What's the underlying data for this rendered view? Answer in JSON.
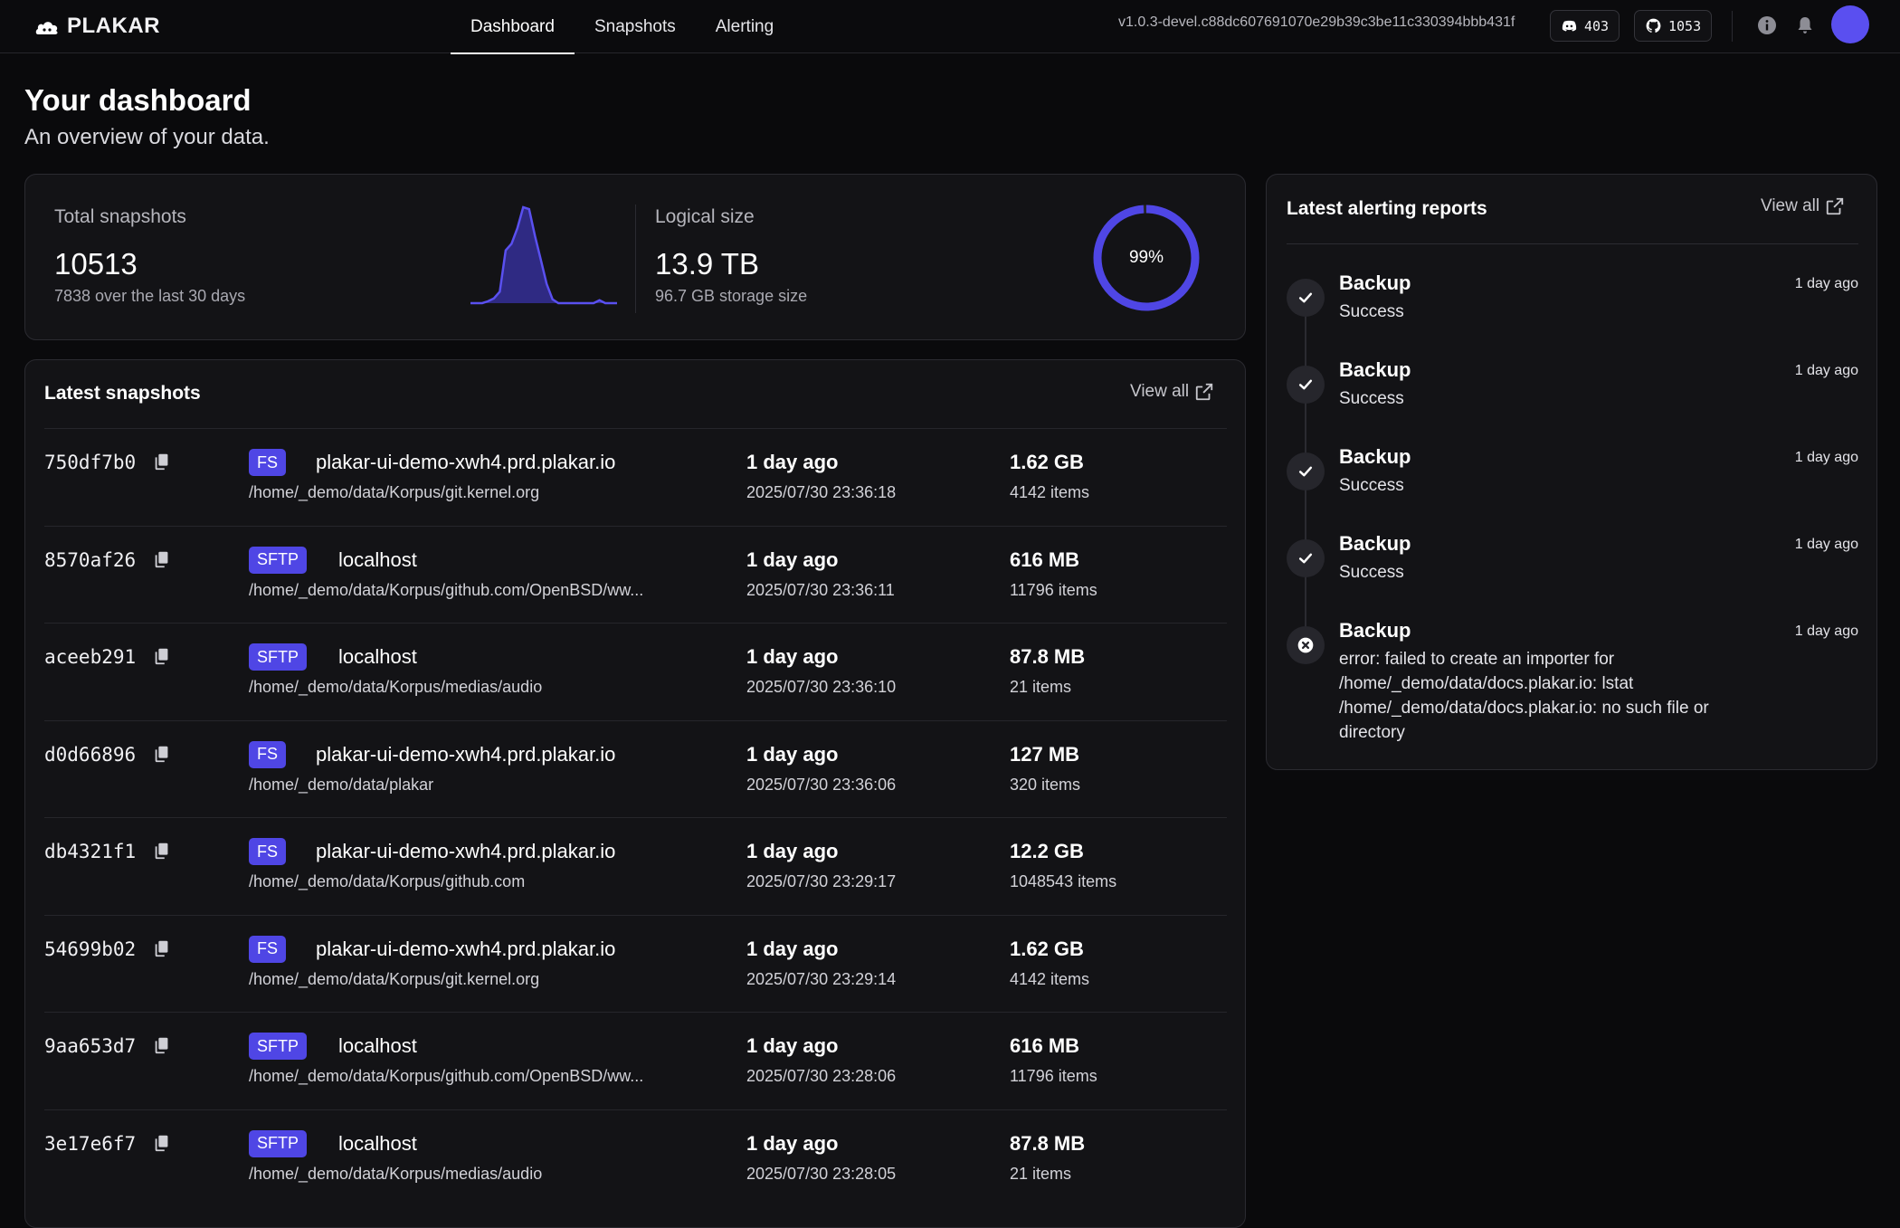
{
  "header": {
    "brand": "PLAKAR",
    "tabs": [
      {
        "label": "Dashboard",
        "active": true
      },
      {
        "label": "Snapshots",
        "active": false
      },
      {
        "label": "Alerting",
        "active": false
      }
    ],
    "version": "v1.0.3-devel.c88dc607691070e29b39c3be11c330394bbb431f",
    "discord_count": "403",
    "github_count": "1053",
    "icons": [
      "discord-icon",
      "github-icon",
      "info-icon",
      "bell-icon",
      "avatar"
    ],
    "accent_color": "#4f46e5"
  },
  "page": {
    "title": "Your dashboard",
    "subtitle": "An overview of your data."
  },
  "stats": {
    "total_label": "Total snapshots",
    "total_value": "10513",
    "total_sub": "7838 over the last 30 days",
    "logical_label": "Logical size",
    "logical_value": "13.9 TB",
    "logical_sub": "96.7 GB storage size",
    "gauge_text": "99%",
    "gauge_fraction": 0.99
  },
  "chart_data": {
    "type": "area",
    "title": "",
    "values": [
      0,
      0,
      0,
      0.02,
      0.05,
      0.12,
      0.55,
      0.62,
      0.78,
      1.0,
      0.98,
      0.7,
      0.45,
      0.2,
      0.04,
      0,
      0,
      0,
      0,
      0,
      0,
      0,
      0.03,
      0,
      0,
      0
    ]
  },
  "snapshots": {
    "title": "Latest snapshots",
    "view_all": "View all",
    "rows": [
      {
        "id": "750df7b0",
        "type": "FS",
        "host": "plakar-ui-demo-xwh4.prd.plakar.io",
        "path": "/home/_demo/data/Korpus/git.kernel.org",
        "ago": "1 day ago",
        "date": "2025/07/30 23:36:18",
        "size": "1.62 GB",
        "items": "4142 items"
      },
      {
        "id": "8570af26",
        "type": "SFTP",
        "host": "localhost",
        "path": "/home/_demo/data/Korpus/github.com/OpenBSD/ww...",
        "ago": "1 day ago",
        "date": "2025/07/30 23:36:11",
        "size": "616 MB",
        "items": "11796 items"
      },
      {
        "id": "aceeb291",
        "type": "SFTP",
        "host": "localhost",
        "path": "/home/_demo/data/Korpus/medias/audio",
        "ago": "1 day ago",
        "date": "2025/07/30 23:36:10",
        "size": "87.8 MB",
        "items": "21 items"
      },
      {
        "id": "d0d66896",
        "type": "FS",
        "host": "plakar-ui-demo-xwh4.prd.plakar.io",
        "path": "/home/_demo/data/plakar",
        "ago": "1 day ago",
        "date": "2025/07/30 23:36:06",
        "size": "127 MB",
        "items": "320 items"
      },
      {
        "id": "db4321f1",
        "type": "FS",
        "host": "plakar-ui-demo-xwh4.prd.plakar.io",
        "path": "/home/_demo/data/Korpus/github.com",
        "ago": "1 day ago",
        "date": "2025/07/30 23:29:17",
        "size": "12.2 GB",
        "items": "1048543 items"
      },
      {
        "id": "54699b02",
        "type": "FS",
        "host": "plakar-ui-demo-xwh4.prd.plakar.io",
        "path": "/home/_demo/data/Korpus/git.kernel.org",
        "ago": "1 day ago",
        "date": "2025/07/30 23:29:14",
        "size": "1.62 GB",
        "items": "4142 items"
      },
      {
        "id": "9aa653d7",
        "type": "SFTP",
        "host": "localhost",
        "path": "/home/_demo/data/Korpus/github.com/OpenBSD/ww...",
        "ago": "1 day ago",
        "date": "2025/07/30 23:28:06",
        "size": "616 MB",
        "items": "11796 items"
      },
      {
        "id": "3e17e6f7",
        "type": "SFTP",
        "host": "localhost",
        "path": "/home/_demo/data/Korpus/medias/audio",
        "ago": "1 day ago",
        "date": "2025/07/30 23:28:05",
        "size": "87.8 MB",
        "items": "21 items"
      }
    ]
  },
  "alerts": {
    "title": "Latest alerting reports",
    "view_all": "View all",
    "items": [
      {
        "title": "Backup",
        "status": "Success",
        "time": "1 day ago",
        "icon": "check-icon"
      },
      {
        "title": "Backup",
        "status": "Success",
        "time": "1 day ago",
        "icon": "check-icon"
      },
      {
        "title": "Backup",
        "status": "Success",
        "time": "1 day ago",
        "icon": "check-icon"
      },
      {
        "title": "Backup",
        "status": "Success",
        "time": "1 day ago",
        "icon": "check-icon"
      },
      {
        "title": "Backup",
        "status": "error: failed to create an importer for /home/_demo/data/docs.plakar.io: lstat /home/_demo/data/docs.plakar.io: no such file or directory",
        "time": "1 day ago",
        "icon": "error-icon"
      }
    ]
  }
}
